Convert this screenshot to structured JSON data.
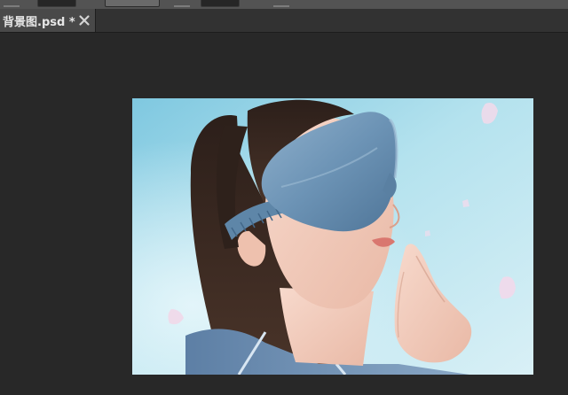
{
  "options_bar": {
    "label": "options-bar"
  },
  "document_tab": {
    "title": "背景图.psd *"
  },
  "colors": {
    "workspace": "#282828",
    "tab_active": "#494949",
    "tab_bar": "#323232",
    "options_bar": "#535353",
    "sky": "#a8dcea",
    "mask": "#6b93b4",
    "hair": "#3a2a22",
    "skin": "#f3cfc0",
    "shirt": "#6e90b5"
  },
  "icons": {
    "close": "close-icon"
  }
}
